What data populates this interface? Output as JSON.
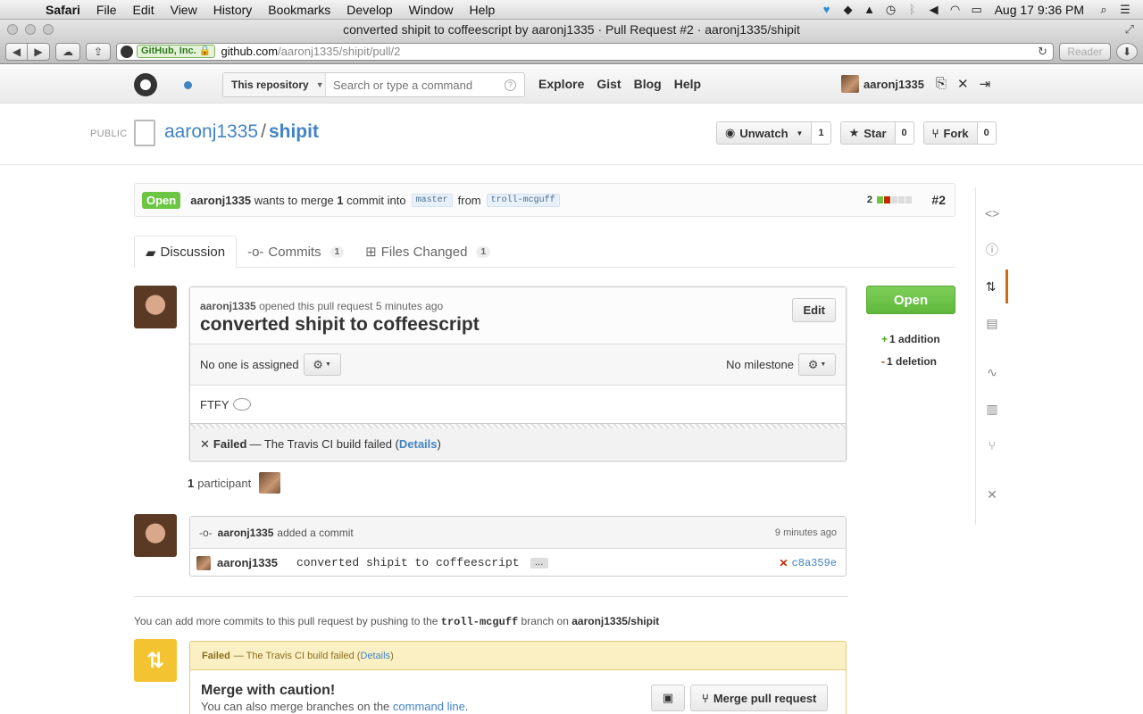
{
  "menubar": {
    "items": [
      "Safari",
      "File",
      "Edit",
      "View",
      "History",
      "Bookmarks",
      "Develop",
      "Window",
      "Help"
    ],
    "clock": "Aug 17  9:36 PM"
  },
  "window": {
    "title": "converted shipit to coffeescript by aaronj1335 · Pull Request #2 · aaronj1335/shipit",
    "cert_label": "GitHub, Inc. 🔒",
    "url_host": "github.com",
    "url_path": "/aaronj1335/shipit/pull/2",
    "reader_label": "Reader"
  },
  "gh_header": {
    "scope_label": "This repository",
    "search_placeholder": "Search or type a command",
    "help_glyph": "?",
    "nav": [
      "Explore",
      "Gist",
      "Blog",
      "Help"
    ],
    "username": "aaronj1335"
  },
  "repo": {
    "visibility": "PUBLIC",
    "owner": "aaronj1335",
    "separator": "/",
    "name": "shipit",
    "watch_label": "Unwatch",
    "watch_count": "1",
    "star_label": "Star",
    "star_count": "0",
    "fork_label": "Fork",
    "fork_count": "0"
  },
  "pr_meta": {
    "state": "Open",
    "author": "aaronj1335",
    "text_a": "wants to merge",
    "commit_count": "1",
    "text_b": "commit into",
    "base": "master",
    "text_c": "from",
    "head": "troll-mcguff",
    "diffstat_count": "2",
    "number": "#2"
  },
  "tabs": [
    {
      "label": "Discussion",
      "count": ""
    },
    {
      "label": "Commits",
      "count": "1"
    },
    {
      "label": "Files Changed",
      "count": "1"
    }
  ],
  "pr": {
    "author": "aaronj1335",
    "opened_text": "opened this pull request 5 minutes ago",
    "title": "converted shipit to coffeescript",
    "edit_label": "Edit",
    "assignee_text": "No one is assigned",
    "milestone_text": "No milestone",
    "body": "FTFY",
    "status_label": "Failed",
    "status_text": "— The Travis CI build failed (",
    "status_link": "Details",
    "status_close": ")"
  },
  "participants": {
    "count": "1",
    "label": "participant"
  },
  "commit_event": {
    "author": "aaronj1335",
    "action": "added a commit",
    "time": "9 minutes ago",
    "row_author": "aaronj1335",
    "message": "converted shipit to coffeescript",
    "ellipsis": "…",
    "sha": "c8a359e"
  },
  "push_note": {
    "text_a": "You can add more commits to this pull request by pushing to the",
    "branch": "troll-mcguff",
    "text_b": "branch on",
    "repo": "aaronj1335/shipit"
  },
  "merge": {
    "status_label": "Failed",
    "status_text": "— The Travis CI build failed (",
    "status_link": "Details",
    "status_close": ")",
    "title": "Merge with caution!",
    "sub_text": "You can also merge branches on the",
    "sub_link": "command line",
    "sub_end": ".",
    "merge_button": "Merge pull request"
  },
  "sidebar_state": {
    "open_label": "Open",
    "additions": "1 addition",
    "deletions": "1 deletion"
  },
  "colors": {
    "open_green": "#6cc644",
    "link_blue": "#4183c4",
    "failed_red": "#bd2c00",
    "warning_yellow": "#f3c332"
  }
}
